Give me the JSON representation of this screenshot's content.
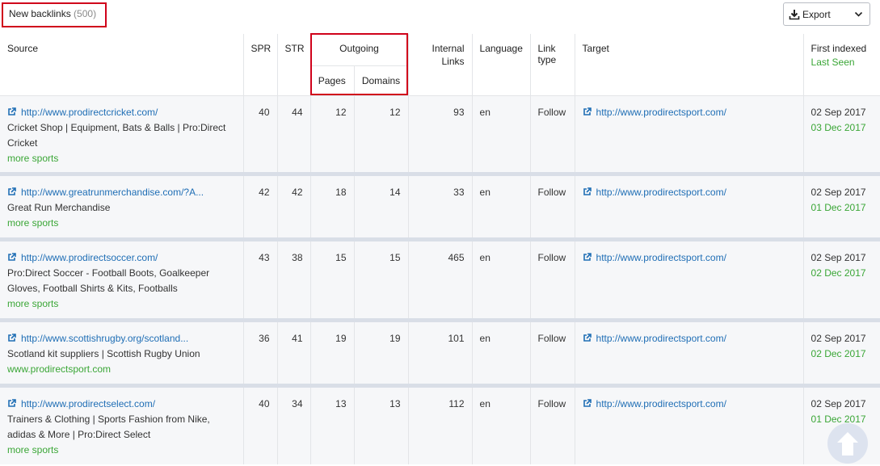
{
  "header": {
    "title": "New backlinks",
    "count": "(500)",
    "export_label": "Export"
  },
  "columns": {
    "source": "Source",
    "spr": "SPR",
    "str": "STR",
    "outgoing": "Outgoing",
    "outgoing_pages": "Pages",
    "outgoing_domains": "Domains",
    "internal_links_1": "Internal",
    "internal_links_2": "Links",
    "language": "Language",
    "link_type_1": "Link",
    "link_type_2": "type",
    "target": "Target",
    "first_indexed": "First indexed",
    "last_seen": "Last Seen"
  },
  "rows": [
    {
      "source_url": "http://www.prodirectcricket.com/",
      "source_title": "Cricket Shop | Equipment, Bats & Balls | Pro:Direct Cricket",
      "source_extra": "more sports",
      "spr": "40",
      "str": "44",
      "pages": "12",
      "domains": "12",
      "internal": "93",
      "language": "en",
      "link_type": "Follow",
      "target": "http://www.prodirectsport.com/",
      "first_indexed": "02 Sep 2017",
      "last_seen": "03 Dec 2017"
    },
    {
      "source_url": "http://www.greatrunmerchandise.com/?A...",
      "source_title": "Great Run Merchandise",
      "source_extra": "more sports",
      "spr": "42",
      "str": "42",
      "pages": "18",
      "domains": "14",
      "internal": "33",
      "language": "en",
      "link_type": "Follow",
      "target": "http://www.prodirectsport.com/",
      "first_indexed": "02 Sep 2017",
      "last_seen": "01 Dec 2017"
    },
    {
      "source_url": "http://www.prodirectsoccer.com/",
      "source_title": "Pro:Direct Soccer - Football Boots, Goalkeeper Gloves, Football Shirts & Kits, Footballs",
      "source_extra": "more sports",
      "spr": "43",
      "str": "38",
      "pages": "15",
      "domains": "15",
      "internal": "465",
      "language": "en",
      "link_type": "Follow",
      "target": "http://www.prodirectsport.com/",
      "first_indexed": "02 Sep 2017",
      "last_seen": "02 Dec 2017"
    },
    {
      "source_url": "http://www.scottishrugby.org/scotland...",
      "source_title": "Scotland kit suppliers | Scottish Rugby Union",
      "source_extra": "www.prodirectsport.com",
      "spr": "36",
      "str": "41",
      "pages": "19",
      "domains": "19",
      "internal": "101",
      "language": "en",
      "link_type": "Follow",
      "target": "http://www.prodirectsport.com/",
      "first_indexed": "02 Sep 2017",
      "last_seen": "02 Dec 2017"
    },
    {
      "source_url": "http://www.prodirectselect.com/",
      "source_title": "Trainers & Clothing | Sports Fashion from Nike, adidas & More | Pro:Direct Select",
      "source_extra": "more sports",
      "spr": "40",
      "str": "34",
      "pages": "13",
      "domains": "13",
      "internal": "112",
      "language": "en",
      "link_type": "Follow",
      "target": "http://www.prodirectsport.com/",
      "first_indexed": "02 Sep 2017",
      "last_seen": "01 Dec 2017"
    }
  ],
  "icons": {
    "external": "external-link-icon",
    "download": "download-icon",
    "chevron": "chevron-down-icon",
    "scroll_top": "arrow-up-icon"
  },
  "colors": {
    "link": "#1f6eb5",
    "green": "#3aa636",
    "highlight": "#d0021b",
    "row_bg": "#f6f7f9",
    "separator": "#d9dee7"
  }
}
